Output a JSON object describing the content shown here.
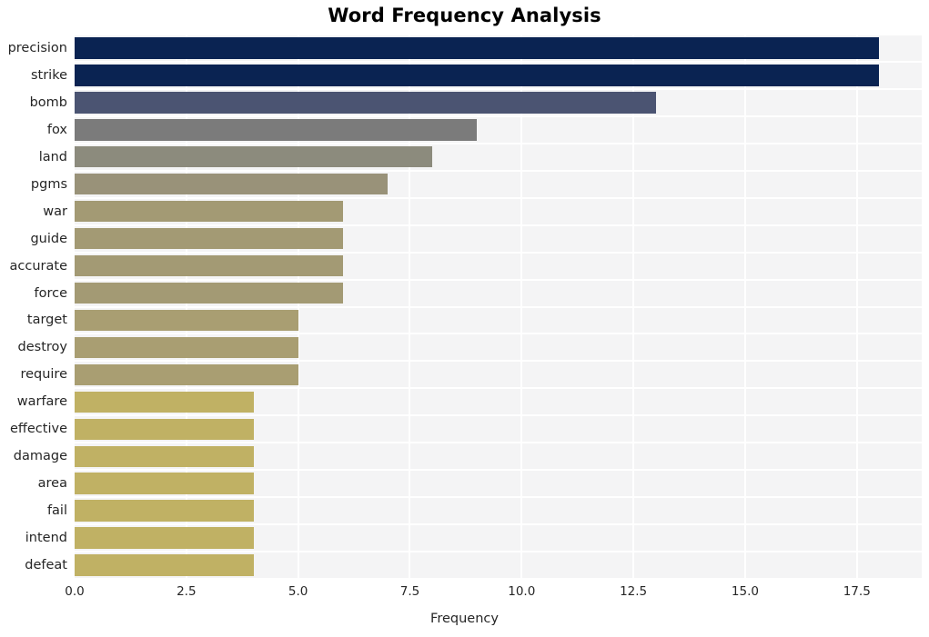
{
  "chart_data": {
    "type": "bar",
    "orientation": "horizontal",
    "title": "Word Frequency Analysis",
    "xlabel": "Frequency",
    "ylabel": "",
    "categories": [
      "precision",
      "strike",
      "bomb",
      "fox",
      "land",
      "pgms",
      "war",
      "guide",
      "accurate",
      "force",
      "target",
      "destroy",
      "require",
      "warfare",
      "effective",
      "damage",
      "area",
      "fail",
      "intend",
      "defeat"
    ],
    "values": [
      18,
      18,
      13,
      9,
      8,
      7,
      6,
      6,
      6,
      6,
      5,
      5,
      5,
      4,
      4,
      4,
      4,
      4,
      4,
      4
    ],
    "colors": [
      "#0a2352",
      "#0a2352",
      "#4b5472",
      "#7b7b7b",
      "#8c8b7d",
      "#999279",
      "#a39a74",
      "#a39a74",
      "#a39a74",
      "#a39a74",
      "#a99e72",
      "#a99e72",
      "#a99e72",
      "#c0b164",
      "#c0b164",
      "#c0b164",
      "#c0b164",
      "#c0b164",
      "#c0b164",
      "#c0b164"
    ],
    "xticks": [
      "0.0",
      "2.5",
      "5.0",
      "7.5",
      "10.0",
      "12.5",
      "15.0",
      "17.5"
    ],
    "xtick_values": [
      0,
      2.5,
      5,
      7.5,
      10,
      12.5,
      15,
      17.5
    ],
    "xlim": [
      0,
      18.95
    ],
    "grid": true,
    "grid_color": "#ffffff",
    "plot_background": "#f4f4f5",
    "figure_background": "#ffffff",
    "legend": null
  }
}
